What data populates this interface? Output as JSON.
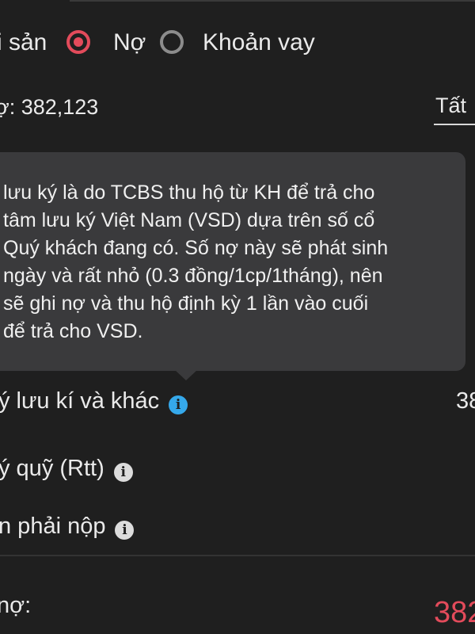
{
  "tabs": {
    "asset_label": "i sản",
    "debt_label": "Nợ",
    "loan_label": "Khoản vay"
  },
  "summary": {
    "total_debt_text": "ợ: 382,123",
    "filter_label": "Tất"
  },
  "tooltip": {
    "lines": [
      "lưu ký là do TCBS thu hộ từ KH để trả cho",
      "tâm lưu ký Việt Nam (VSD) dựa trên số cổ",
      "Quý khách đang có. Số nợ này sẽ phát sinh",
      "ngày và rất nhỏ (0.3 đồng/1cp/1tháng), nên",
      "sẽ ghi nợ và thu hộ định kỳ 1 lần vào cuối",
      "để trả cho VSD."
    ]
  },
  "rows": [
    {
      "label": "ý lưu kí và khác",
      "value": "38",
      "icon": "info-icon",
      "icon_color": "#35a8ea"
    },
    {
      "label": "ý quỹ (Rtt)",
      "icon": "info-icon",
      "icon_color": "#dcdcdc"
    },
    {
      "label": "n phải nộp",
      "icon": "info-icon",
      "icon_color": "#dcdcdc"
    }
  ],
  "footer": {
    "label": "nợ:",
    "value": "382"
  },
  "colors": {
    "accent": "#e34b5b",
    "info_blue": "#35a8ea",
    "background": "#1f1f1f"
  }
}
